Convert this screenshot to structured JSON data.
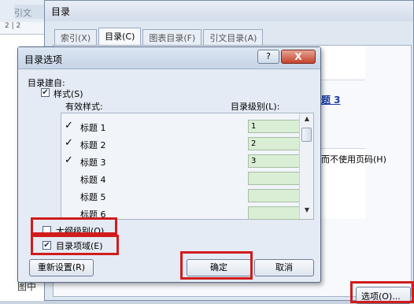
{
  "background": {
    "ref_tab": "引文",
    "ruler_text": "2 | 2",
    "image_caption_fragment": "图中"
  },
  "toc_dialog": {
    "title": "目录",
    "tabs": [
      {
        "label": "索引(X)",
        "active": false
      },
      {
        "label": "目录(C)",
        "active": true
      },
      {
        "label": "图表目录(F)",
        "active": false
      },
      {
        "label": "引文目录(A)",
        "active": false
      }
    ],
    "preview_heading": "题 3",
    "web_preview_text": "而不使用页码(H)",
    "options_button": "选项(O)..."
  },
  "options_dialog": {
    "title": "目录选项",
    "help_button": "?",
    "close_button": "X",
    "build_from_label": "目录建自:",
    "styles_checkbox": {
      "label": "样式(S)",
      "checked": true
    },
    "available_styles_header": "有效样式:",
    "toc_level_header": "目录级别(L):",
    "styles": [
      {
        "name": "标题 1",
        "checked": true,
        "level": "1"
      },
      {
        "name": "标题 2",
        "checked": true,
        "level": "2"
      },
      {
        "name": "标题 3",
        "checked": true,
        "level": "3"
      },
      {
        "name": "标题 4",
        "checked": false,
        "level": ""
      },
      {
        "name": "标题 5",
        "checked": false,
        "level": ""
      },
      {
        "name": "标题 6",
        "checked": false,
        "level": ""
      }
    ],
    "outline_level_checkbox": {
      "label": "大纲级别(O)",
      "checked": false
    },
    "toc_entry_fields_checkbox": {
      "label": "目录项域(E)",
      "checked": true
    },
    "reset_button": "重新设置(R)",
    "ok_button": "确定",
    "cancel_button": "取消"
  },
  "colors": {
    "highlight": "#d11c1c",
    "level_field": "#d9eed5",
    "link": "#1c3aa9"
  }
}
